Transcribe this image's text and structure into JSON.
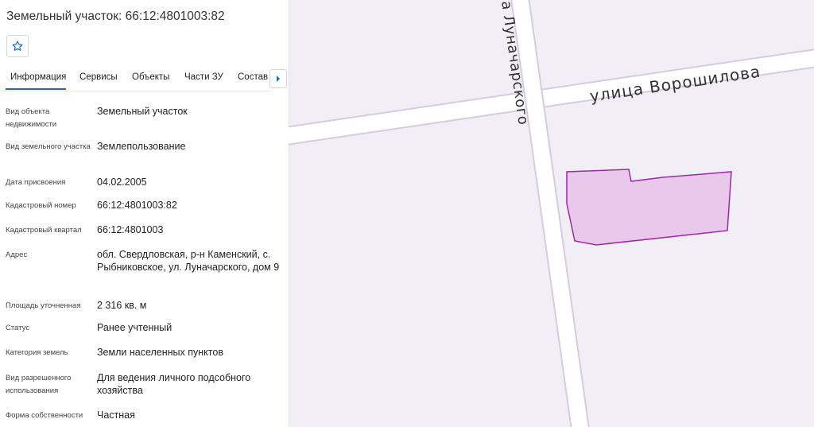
{
  "panel": {
    "title": "Земельный участок: 66:12:4801003:82",
    "favorite_icon": "star-icon",
    "tabs": [
      "Информация",
      "Сервисы",
      "Объекты",
      "Части ЗУ",
      "Состав"
    ],
    "next_icon": "chevron-right-icon",
    "fields": [
      {
        "label": "Вид объекта недвижимости",
        "value": "Земельный участок"
      },
      {
        "label": "Вид земельного участка",
        "value": "Землепользование"
      },
      {
        "label": "Дата присвоения",
        "value": "04.02.2005"
      },
      {
        "label": "Кадастровый номер",
        "value": "66:12:4801003:82"
      },
      {
        "label": "Кадастровый квартал",
        "value": "66:12:4801003"
      },
      {
        "label": "Адрес",
        "value": "обл. Свердловская, р-н Каменский, с. Рыбниковское, ул. Луначарского, дом 9"
      },
      {
        "label": "Площадь уточненная",
        "value": "2 316 кв. м"
      },
      {
        "label": "Статус",
        "value": "Ранее учтенный"
      },
      {
        "label": "Категория земель",
        "value": "Земли населенных пунктов"
      },
      {
        "label": "Вид разрешенного использования",
        "value": "Для ведения личного подсобного хозяйства"
      },
      {
        "label": "Форма собственности",
        "value": "Частная"
      }
    ]
  },
  "map": {
    "street_horizontal": "улица Ворошилова",
    "street_vertical": "а Луначарского",
    "colors": {
      "background": "#f1eef6",
      "road": "#ffffff",
      "road_edge": "#d2cde0",
      "parcel_fill": "#e9c8ec",
      "parcel_stroke": "#9b2aa8",
      "accent": "#1c66c6"
    }
  }
}
